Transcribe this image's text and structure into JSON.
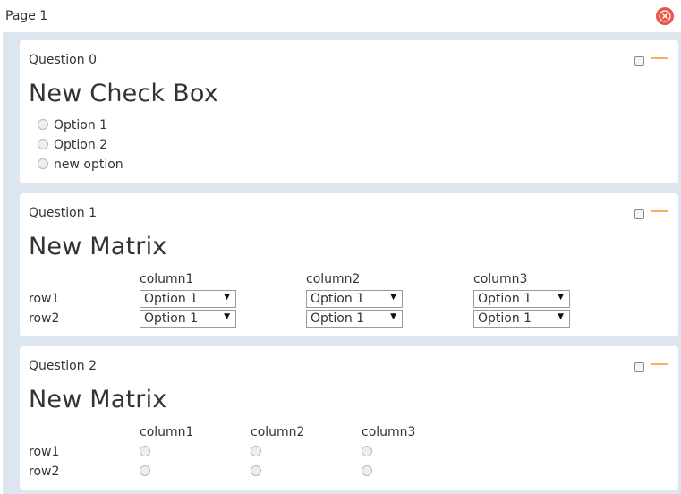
{
  "page": {
    "title": "Page 1"
  },
  "questions": [
    {
      "label": "Question 0",
      "title": "New Check Box",
      "options": [
        "Option 1",
        "Option 2",
        "new option"
      ]
    },
    {
      "label": "Question 1",
      "title": "New Matrix",
      "columns": [
        "column1",
        "column2",
        "column3"
      ],
      "rows": [
        "row1",
        "row2"
      ],
      "cells": [
        [
          "Option 1",
          "Option 1",
          "Option 1"
        ],
        [
          "Option 1",
          "Option 1",
          "Option 1"
        ]
      ]
    },
    {
      "label": "Question 2",
      "title": "New Matrix",
      "columns": [
        "column1",
        "column2",
        "column3"
      ],
      "rows": [
        "row1",
        "row2"
      ]
    }
  ],
  "colors": {
    "delete": "#e8534a",
    "collapse": "#f5b05a",
    "canvas": "#dde6ef"
  },
  "icons": {
    "delete_page": "close-circle-icon",
    "collapse": "minus-icon"
  }
}
